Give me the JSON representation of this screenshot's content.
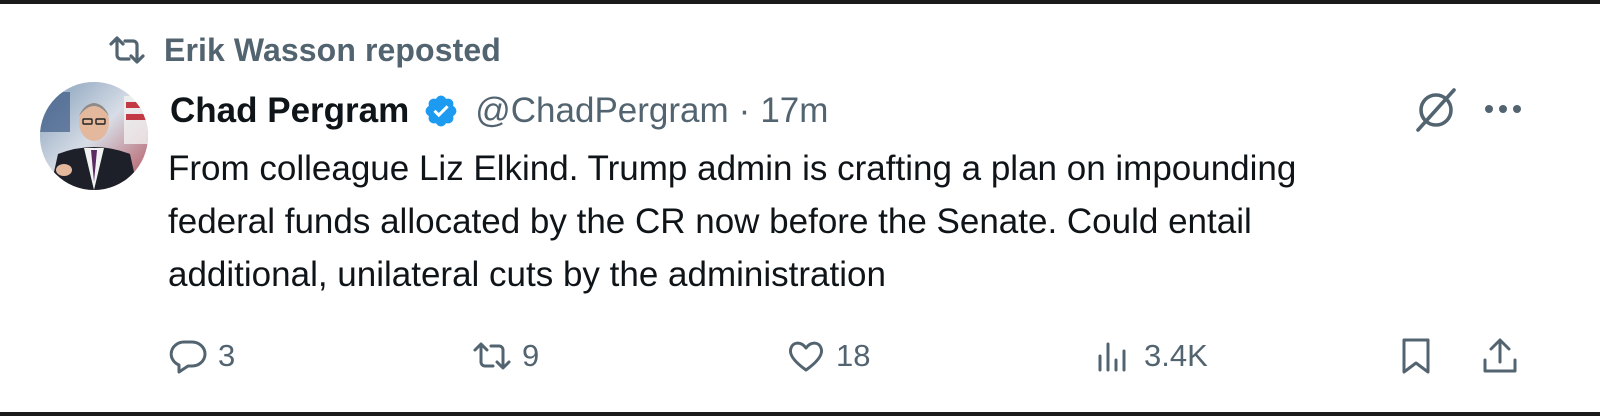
{
  "repost": {
    "icon": "repost-icon",
    "label": "Erik Wasson reposted"
  },
  "author": {
    "name": "Chad Pergram",
    "verified": true,
    "verified_color": "#1d9bf0",
    "handle": "@ChadPergram",
    "separator": "·",
    "time": "17m"
  },
  "tweet": {
    "line1": "From colleague Liz Elkind. Trump admin is crafting a plan on impounding",
    "line2": "federal funds allocated by the CR now before the Senate. Could entail",
    "line3": "additional, unilateral cuts by the administration"
  },
  "actions": {
    "replies": "3",
    "reposts": "9",
    "likes": "18",
    "views": "3.4K"
  },
  "icons": {
    "top_right": [
      "grok-icon",
      "more-icon"
    ],
    "actions": [
      "reply-icon",
      "repost-icon",
      "like-icon",
      "views-icon",
      "bookmark-icon",
      "share-icon"
    ]
  },
  "colors": {
    "text_primary": "#0f1419",
    "text_secondary": "#536471",
    "accent": "#1d9bf0"
  }
}
